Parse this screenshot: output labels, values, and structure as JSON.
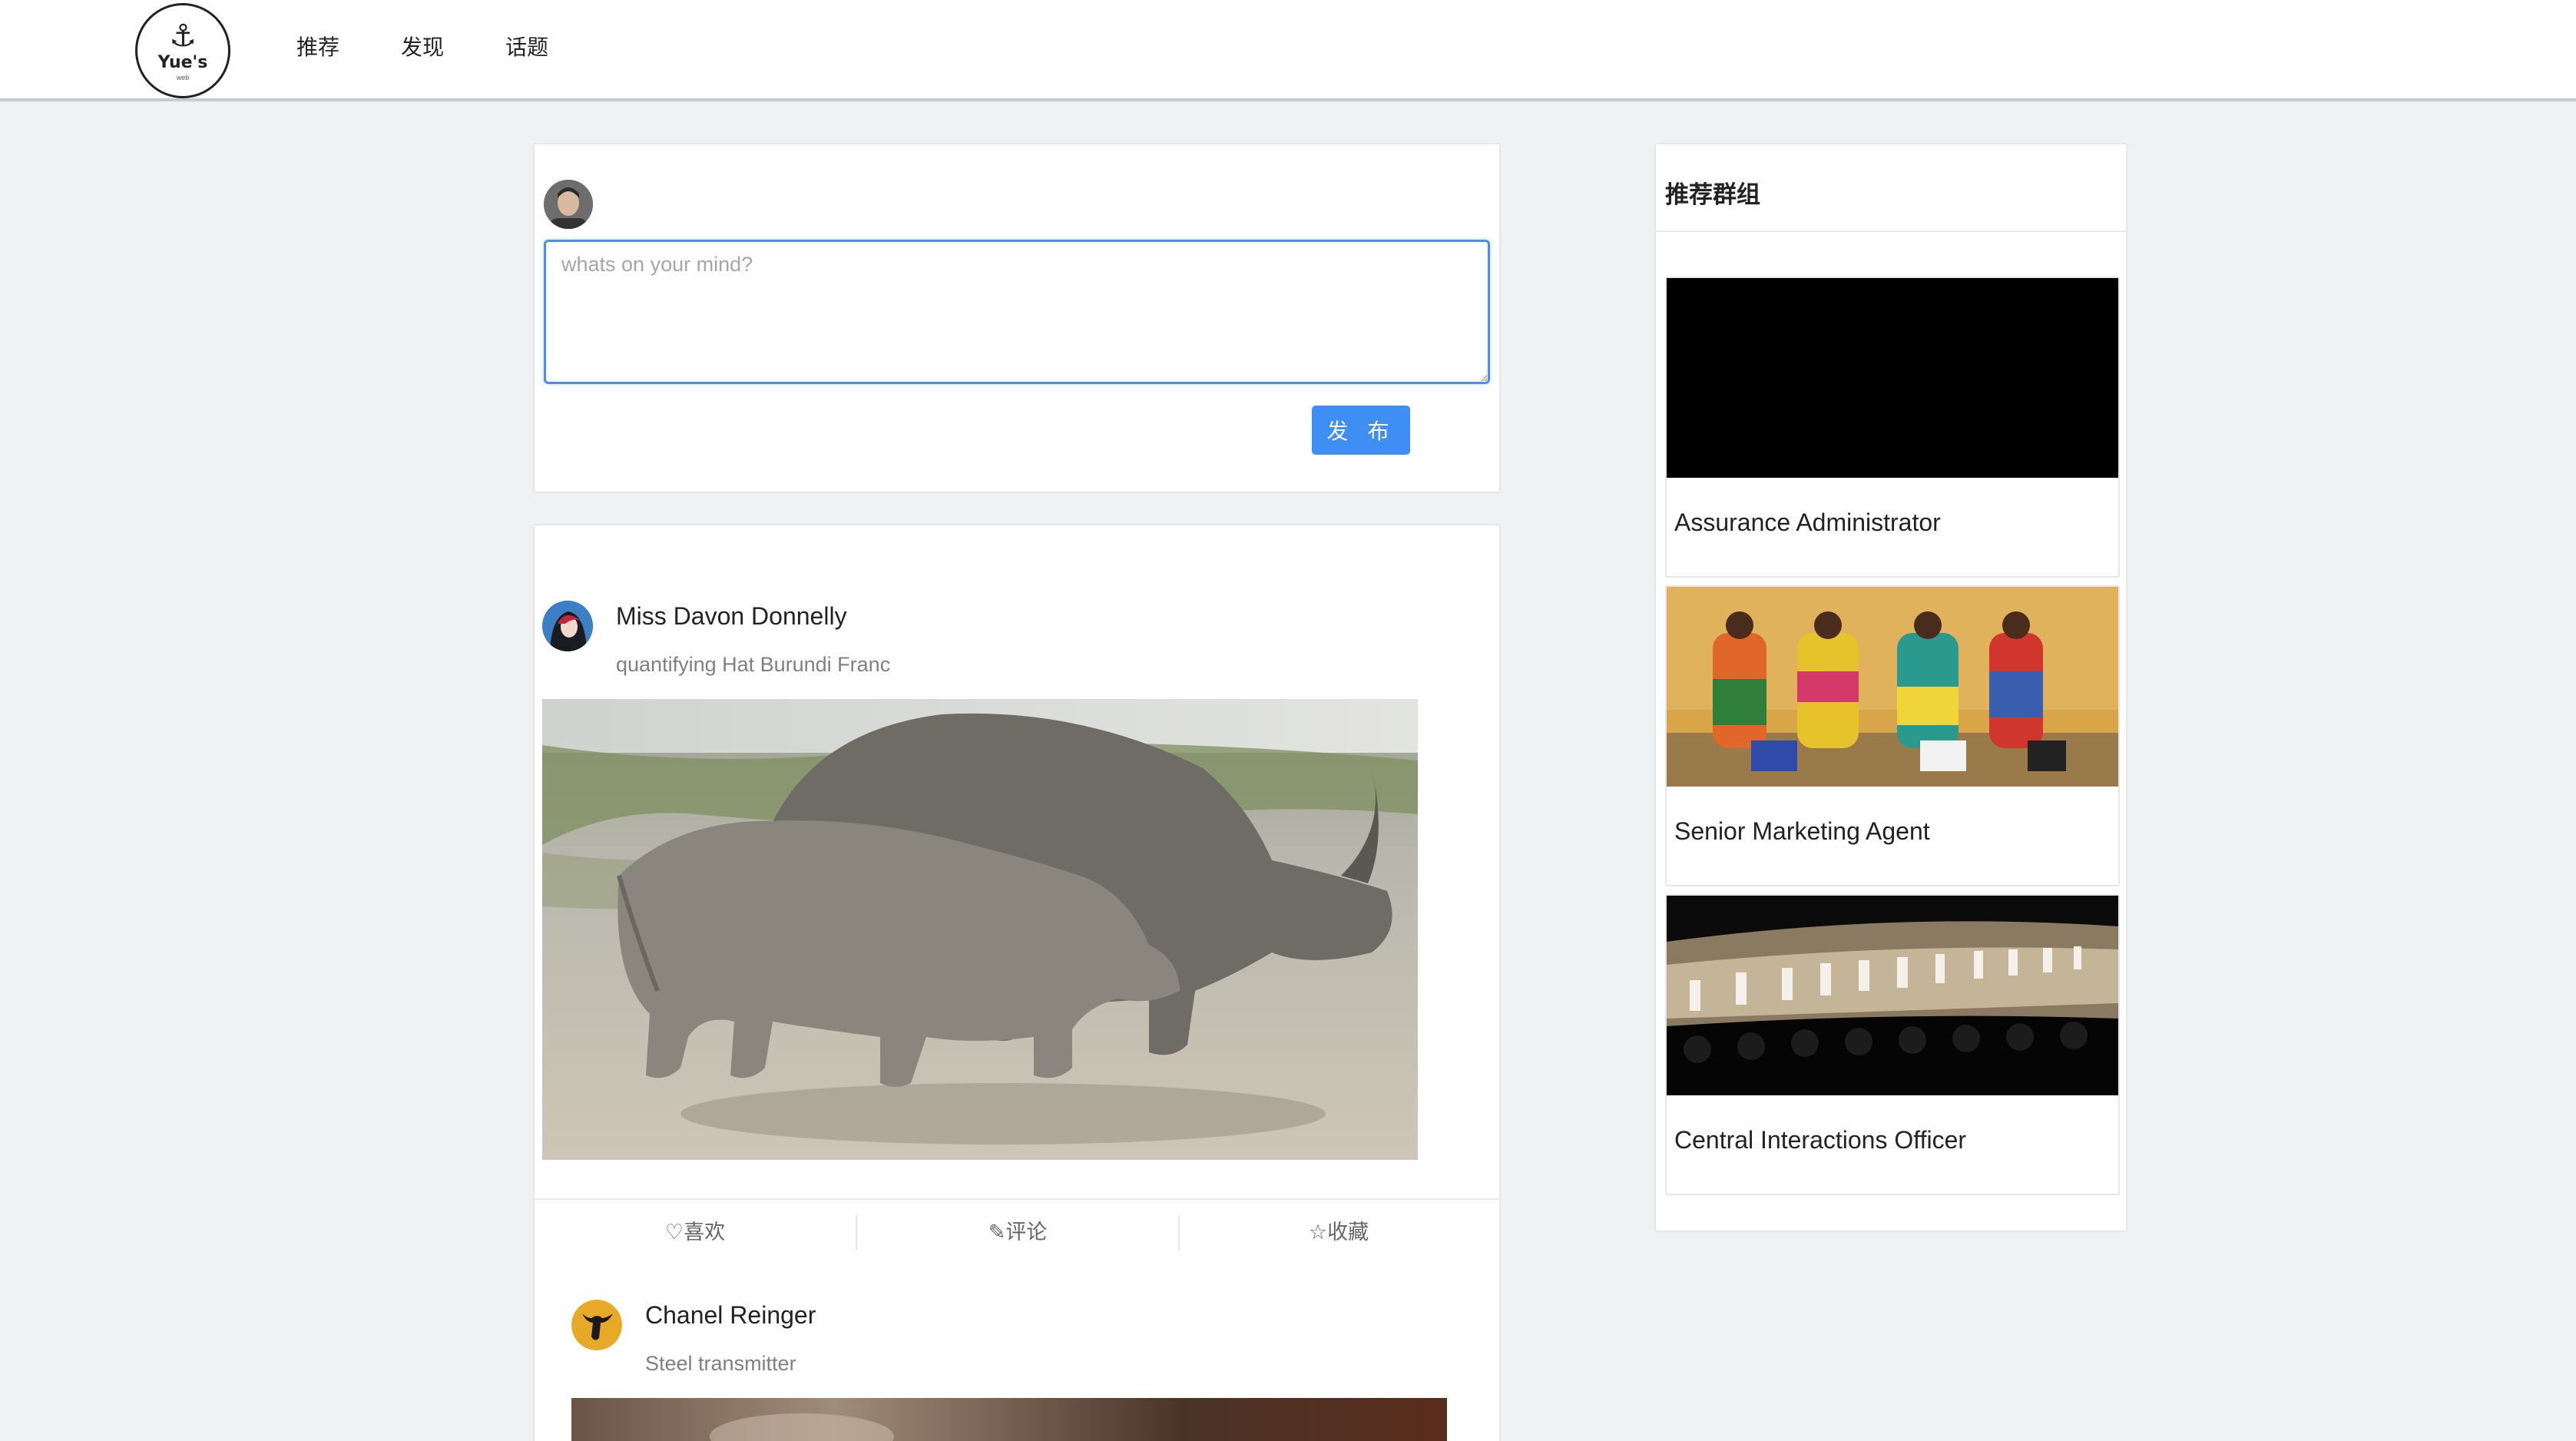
{
  "logo": {
    "brand": "Yue's",
    "sub": "web"
  },
  "nav": {
    "items": [
      "推荐",
      "发现",
      "话题"
    ]
  },
  "composer": {
    "placeholder": "whats on your mind?",
    "publish_label": "发 布"
  },
  "posts": [
    {
      "author": "Miss Davon Donnelly",
      "subtitle": "quantifying Hat Burundi Franc"
    },
    {
      "author": "Chanel Reinger",
      "subtitle": "Steel transmitter"
    }
  ],
  "actions": {
    "like": "喜欢",
    "comment": "评论",
    "collect": "收藏"
  },
  "sidebar": {
    "title": "推荐群组",
    "groups": [
      {
        "name": "Assurance Administrator"
      },
      {
        "name": "Senior Marketing Agent"
      },
      {
        "name": "Central Interactions Officer"
      }
    ]
  },
  "icons": {
    "logo": "anchor-icon",
    "like": "heart-outline-icon",
    "comment": "pencil-icon",
    "collect": "star-outline-icon"
  },
  "colors": {
    "accent": "#3f8ef4",
    "page_bg": "#f0f1f3",
    "focus_border": "#4c8ee8"
  }
}
